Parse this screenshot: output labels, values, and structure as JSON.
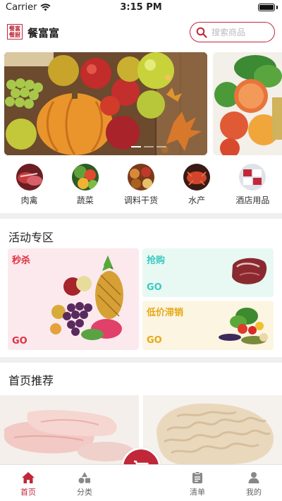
{
  "status_bar": {
    "carrier": "Carrier",
    "time": "3:15 PM",
    "battery_level": 1.0
  },
  "header": {
    "logo_text": "餐富餐厨",
    "app_name": "餐富富",
    "search_placeholder": "搜索商品"
  },
  "banner": {
    "slide_count": 3,
    "active_index": 0
  },
  "categories": [
    {
      "label": "肉禽",
      "icon": "meat-icon"
    },
    {
      "label": "蔬菜",
      "icon": "vegetable-icon"
    },
    {
      "label": "调料干货",
      "icon": "seasoning-icon"
    },
    {
      "label": "水产",
      "icon": "seafood-icon"
    },
    {
      "label": "酒店用品",
      "icon": "hotel-supplies-icon"
    }
  ],
  "activity": {
    "title": "活动专区",
    "flash_sale": {
      "title": "秒杀",
      "go": "GO",
      "color": "#e03040"
    },
    "rush_buy": {
      "title": "抢购",
      "go": "GO",
      "color": "#3cc9c0"
    },
    "clearance": {
      "title": "低价滞销",
      "go": "GO",
      "color": "#e6a817"
    }
  },
  "recommend": {
    "title": "首页推荐"
  },
  "tabs": [
    {
      "label": "首页",
      "icon": "home-icon",
      "active": true
    },
    {
      "label": "分类",
      "icon": "category-icon",
      "active": false
    },
    {
      "label": "清单",
      "icon": "list-icon",
      "active": false
    },
    {
      "label": "我的",
      "icon": "profile-icon",
      "active": false
    }
  ],
  "colors": {
    "brand": "#c0283a"
  }
}
